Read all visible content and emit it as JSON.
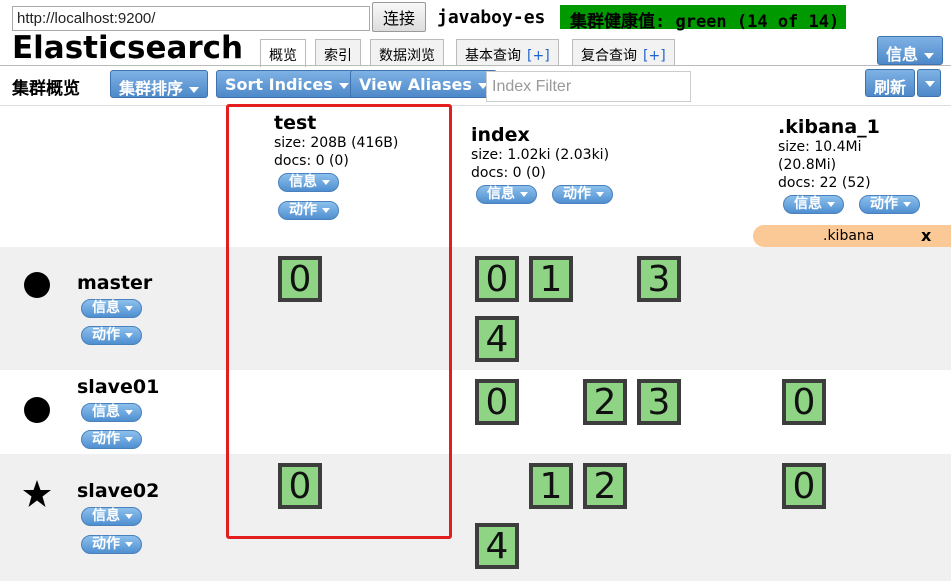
{
  "header": {
    "url_value": "http://localhost:9200/",
    "connect_label": "连接",
    "cluster_name": "javaboy-es",
    "health_text": "集群健康值: green (14 of 14)",
    "health_color": "#009900",
    "app_title": "Elasticsearch",
    "info_label": "信息"
  },
  "tabs": [
    {
      "label": "概览",
      "active": true
    },
    {
      "label": "索引"
    },
    {
      "label": "数据浏览"
    },
    {
      "label": "基本查询",
      "plus": "[+]"
    },
    {
      "label": "复合查询",
      "plus": "[+]"
    }
  ],
  "toolbar": {
    "overview_label": "集群概览",
    "cluster_sort_label": "集群排序",
    "sort_indices_label": "Sort Indices",
    "view_aliases_label": "View Aliases",
    "index_filter_placeholder": "Index Filter",
    "refresh_label": "刷新"
  },
  "pill_labels": {
    "info": "信息",
    "action": "动作"
  },
  "indices": [
    {
      "name": "test",
      "size": "size: 208B (416B)",
      "docs": "docs: 0 (0)"
    },
    {
      "name": "index",
      "size": "size: 1.02ki (2.03ki)",
      "docs": "docs: 0 (0)"
    },
    {
      "name": ".kibana_1",
      "size": "size: 10.4Mi",
      "size2": "(20.8Mi)",
      "docs": "docs: 22 (52)"
    }
  ],
  "alias": {
    "name": ".kibana",
    "close": "x"
  },
  "nodes": [
    {
      "name": "master",
      "icon": "circle-icon"
    },
    {
      "name": "slave01",
      "icon": "circle-icon"
    },
    {
      "name": "slave02",
      "icon": "star-icon"
    }
  ],
  "shards": {
    "master": {
      "test": [
        "0"
      ],
      "index": [
        "0",
        "1",
        "3",
        "4"
      ],
      "kibana": []
    },
    "slave01": {
      "test": [],
      "index": [
        "0",
        "2",
        "3"
      ],
      "kibana": [
        "0"
      ]
    },
    "slave02": {
      "test": [
        "0"
      ],
      "index": [
        "1",
        "2",
        "4"
      ],
      "kibana": [
        "0"
      ]
    }
  },
  "colors": {
    "shard_fill": "#8fd485",
    "accent_blue": "#4d88c8",
    "alias_bg": "#fbc995",
    "highlight": "#e41e1e"
  }
}
